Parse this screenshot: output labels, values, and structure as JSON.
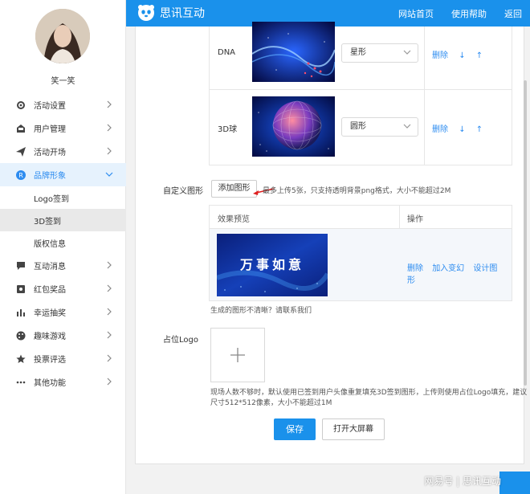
{
  "header": {
    "brand": "思讯互动",
    "nav": [
      "网站首页",
      "使用帮助",
      "返回"
    ]
  },
  "sidebar": {
    "username": "笑一笑",
    "menu": [
      {
        "label": "活动设置"
      },
      {
        "label": "用户管理"
      },
      {
        "label": "活动开场"
      },
      {
        "label": "品牌形象"
      },
      {
        "label": "互动消息"
      },
      {
        "label": "红包奖品"
      },
      {
        "label": "幸运抽奖"
      },
      {
        "label": "趣味游戏"
      },
      {
        "label": "投票评选"
      },
      {
        "label": "其他功能"
      }
    ],
    "submenu": [
      "Logo签到",
      "3D签到",
      "版权信息"
    ]
  },
  "shapes": [
    {
      "name": "DNA",
      "select": "星形",
      "ops": [
        "删除",
        "↓",
        "↑"
      ]
    },
    {
      "name": "3D球",
      "select": "圆形",
      "ops": [
        "删除",
        "↓",
        "↑"
      ]
    }
  ],
  "custom": {
    "label": "自定义图形",
    "add_button": "添加图形",
    "hint": "最多上传5张，只支持透明背景png格式，大小不能超过2M",
    "table_headers": [
      "效果预览",
      "操作"
    ],
    "preview_text": "万事如意",
    "ops": [
      "删除",
      "加入变幻",
      "设计图形"
    ],
    "note": "生成的图形不清晰？请联系我们"
  },
  "placeholder_logo": {
    "label": "占位Logo",
    "hint_line1": "现场人数不够时，默认使用已签到用户头像重复填充3D签到图形，上传则使用占位Logo填充，建议",
    "hint_line2": "尺寸512*512像素，大小不能超过1M"
  },
  "actions": {
    "save": "保存",
    "open_screen": "打开大屏幕"
  },
  "watermark": "网易号 | 思讯互动",
  "colors": {
    "primary": "#1a91eb",
    "link": "#2d8cf0",
    "active_bg": "#e6f2fd"
  }
}
